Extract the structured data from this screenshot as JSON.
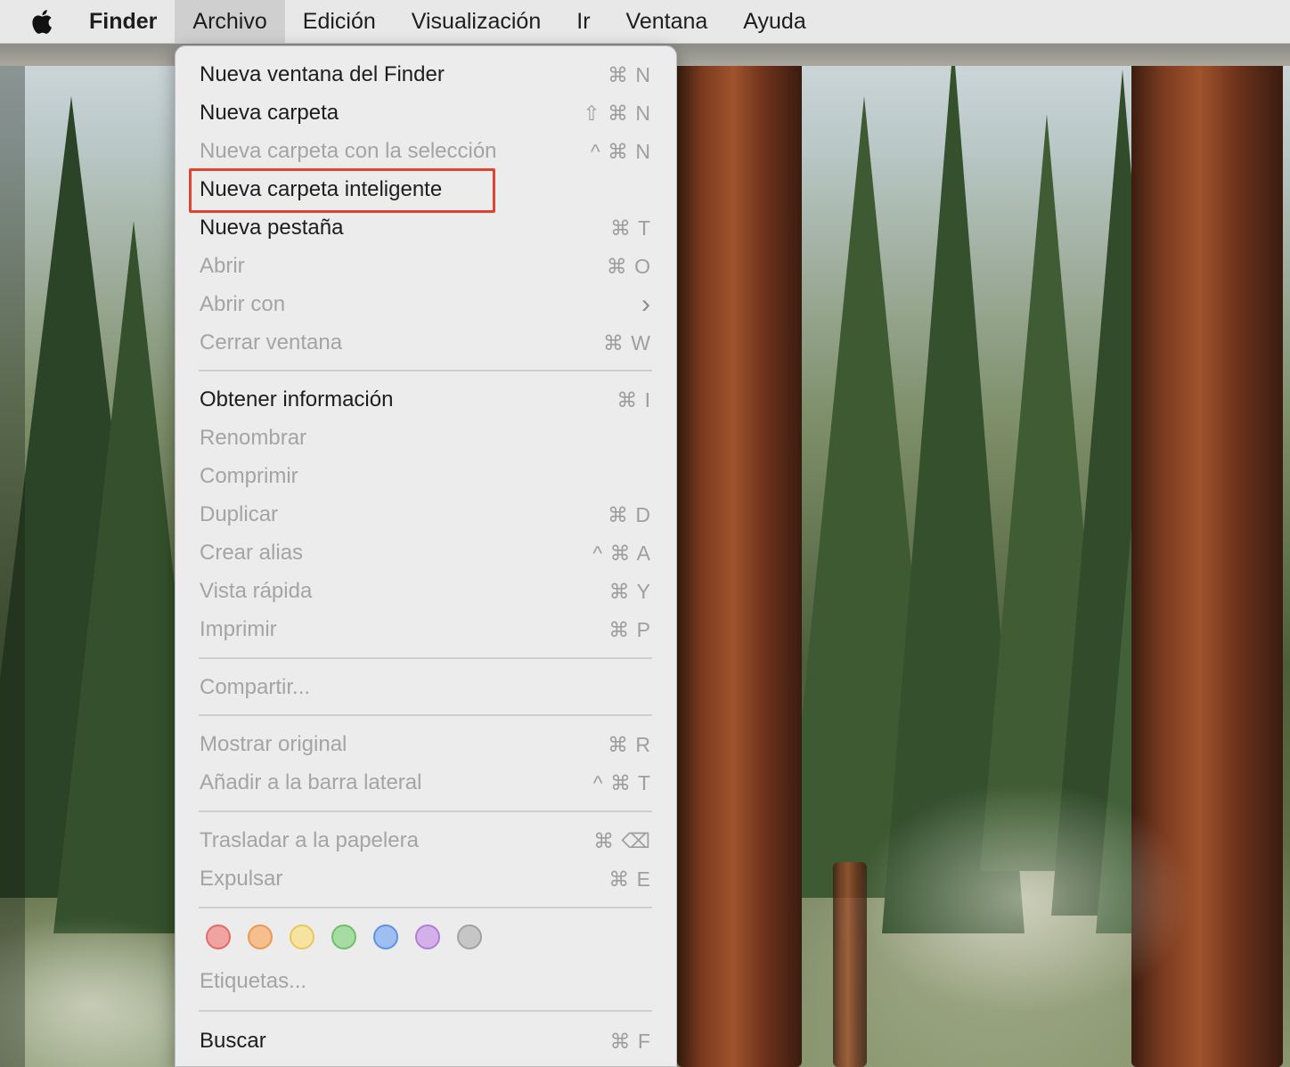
{
  "menubar": {
    "apple_icon": "apple-logo-icon",
    "items": [
      {
        "label": "Finder"
      },
      {
        "label": "Archivo"
      },
      {
        "label": "Edición"
      },
      {
        "label": "Visualización"
      },
      {
        "label": "Ir"
      },
      {
        "label": "Ventana"
      },
      {
        "label": "Ayuda"
      }
    ]
  },
  "menu": {
    "items": [
      {
        "label": "Nueva ventana del Finder",
        "shortcut": "⌘ N",
        "enabled": true
      },
      {
        "label": "Nueva carpeta",
        "shortcut": "⇧ ⌘ N",
        "enabled": true
      },
      {
        "label": "Nueva carpeta con la selección",
        "shortcut": "^ ⌘ N",
        "enabled": false
      },
      {
        "label": "Nueva carpeta inteligente",
        "shortcut": "",
        "enabled": true,
        "highlighted": true
      },
      {
        "label": "Nueva pestaña",
        "shortcut": "⌘ T",
        "enabled": true
      },
      {
        "label": "Abrir",
        "shortcut": "⌘ O",
        "enabled": false
      },
      {
        "label": "Abrir con",
        "shortcut": "›",
        "enabled": false
      },
      {
        "label": "Cerrar ventana",
        "shortcut": "⌘ W",
        "enabled": false
      },
      {
        "label": "Obtener información",
        "shortcut": "⌘ I",
        "enabled": true
      },
      {
        "label": "Renombrar",
        "shortcut": "",
        "enabled": false
      },
      {
        "label": "Comprimir",
        "shortcut": "",
        "enabled": false
      },
      {
        "label": "Duplicar",
        "shortcut": "⌘ D",
        "enabled": false
      },
      {
        "label": "Crear alias",
        "shortcut": "^ ⌘ A",
        "enabled": false
      },
      {
        "label": "Vista rápida",
        "shortcut": "⌘ Y",
        "enabled": false
      },
      {
        "label": "Imprimir",
        "shortcut": "⌘ P",
        "enabled": false
      },
      {
        "label": "Compartir...",
        "shortcut": "",
        "enabled": false
      },
      {
        "label": "Mostrar original",
        "shortcut": "⌘ R",
        "enabled": false
      },
      {
        "label": "Añadir a la barra lateral",
        "shortcut": "^ ⌘ T",
        "enabled": false
      },
      {
        "label": "Trasladar a la papelera",
        "shortcut": "⌘ ⌫",
        "enabled": false
      },
      {
        "label": "Expulsar",
        "shortcut": "⌘ E",
        "enabled": false
      },
      {
        "label": "Etiquetas...",
        "shortcut": "",
        "enabled": false
      },
      {
        "label": "Buscar",
        "shortcut": "⌘ F",
        "enabled": true
      }
    ],
    "tag_colors": [
      {
        "name": "red",
        "fill": "#f0a3a0",
        "ring": "#e06c66"
      },
      {
        "name": "orange",
        "fill": "#f5c08e",
        "ring": "#e89a55"
      },
      {
        "name": "yellow",
        "fill": "#f7e3a0",
        "ring": "#e6c95c"
      },
      {
        "name": "green",
        "fill": "#a6dca2",
        "ring": "#6fbf69"
      },
      {
        "name": "blue",
        "fill": "#9fbff3",
        "ring": "#5f92e6"
      },
      {
        "name": "purple",
        "fill": "#d3b0ea",
        "ring": "#b07ed6"
      },
      {
        "name": "gray",
        "fill": "#c6c6c6",
        "ring": "#a2a2a2"
      }
    ],
    "highlight_color": "#e0432f"
  }
}
